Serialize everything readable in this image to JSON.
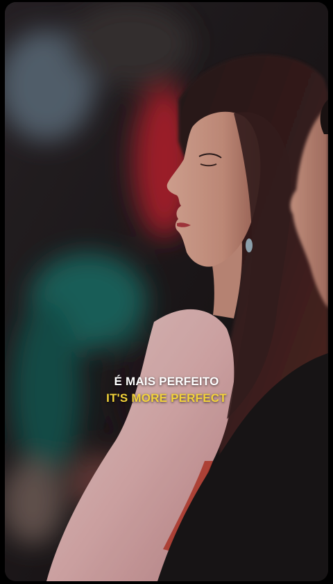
{
  "captions": {
    "original": "É MAIS PERFEITO",
    "translation": "IT'S MORE PERFECT"
  },
  "colors": {
    "caption_original": "#ffffff",
    "caption_translation": "#f3d33a",
    "background": "#000000"
  }
}
